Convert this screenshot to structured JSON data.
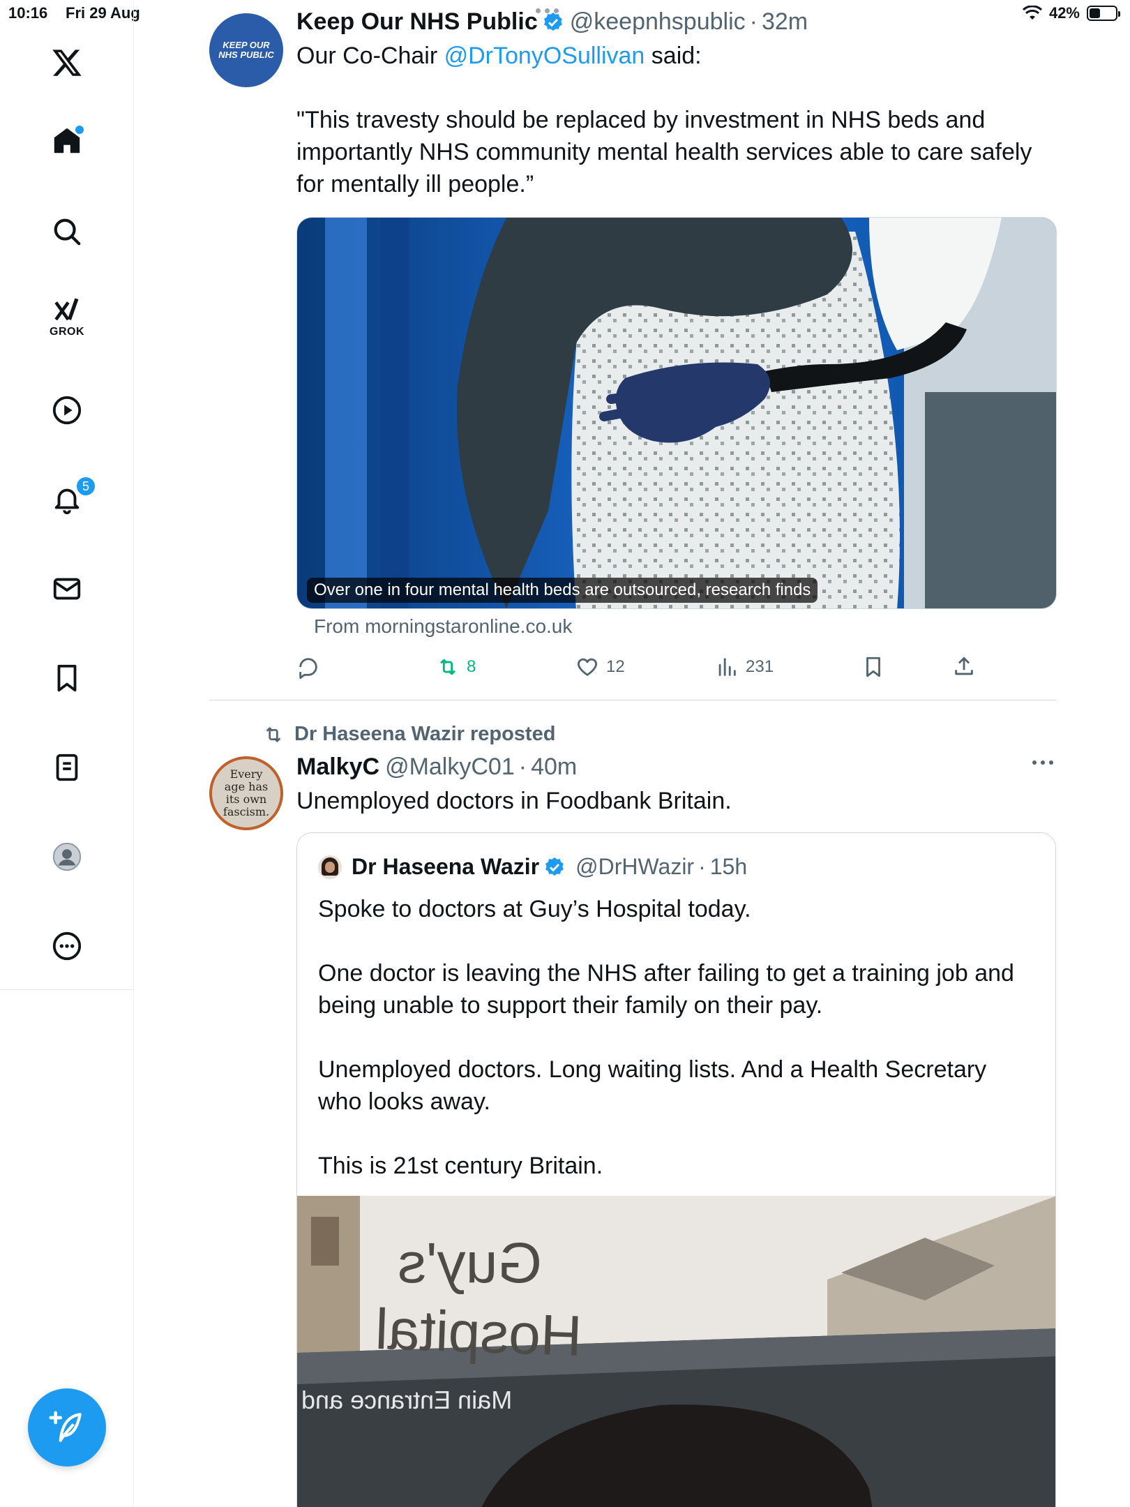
{
  "status_bar": {
    "time": "10:16",
    "date": "Fri 29 Aug",
    "battery": "42%",
    "battery_level": 0.42
  },
  "sidebar": {
    "grok_label": "GROK",
    "notifications_count": "5"
  },
  "post1": {
    "name": "Keep Our NHS Public",
    "handle": "@keepnhspublic",
    "time": "32m",
    "avatar_text_line1": "KEEP OUR",
    "avatar_text_line2": "NHS PUBLIC",
    "text_prefix": "Our Co-Chair ",
    "mention": "@DrTonyOSullivan",
    "text_suffix": " said:",
    "quote_text": "\"This travesty should be replaced by investment in NHS beds and importantly NHS community mental health services able to care safely for mentally ill people.”",
    "media_caption": "Over one in four mental health beds are outsourced, research finds",
    "link_source": "From morningstaronline.co.uk",
    "retweets": "8",
    "likes": "12",
    "views": "231"
  },
  "post2": {
    "reposted_by": "Dr Haseena Wazir reposted",
    "name": "MalkyC",
    "handle": "@MalkyC01",
    "time": "40m",
    "avatar_text": "Every age has its own fascism.",
    "text": "Unemployed doctors in Foodbank Britain.",
    "quoted": {
      "name": "Dr Haseena Wazir",
      "handle": "@DrHWazir",
      "time": "15h",
      "text": "Spoke to doctors at Guy’s Hospital today.\n\nOne doctor is leaving the NHS after failing to get a training job and being unable to support their family on their pay.\n\nUnemployed doctors. Long waiting lists. And a Health Secretary who looks away.\n\nThis is 21st century Britain.",
      "sign_line1": "Guy's",
      "sign_line2": "Hospital",
      "sign_line3": "Main Entrance and"
    }
  },
  "colors": {
    "accent": "#1d9bf0",
    "retweet_green": "#00ba7c",
    "secondary_text": "#536471"
  }
}
